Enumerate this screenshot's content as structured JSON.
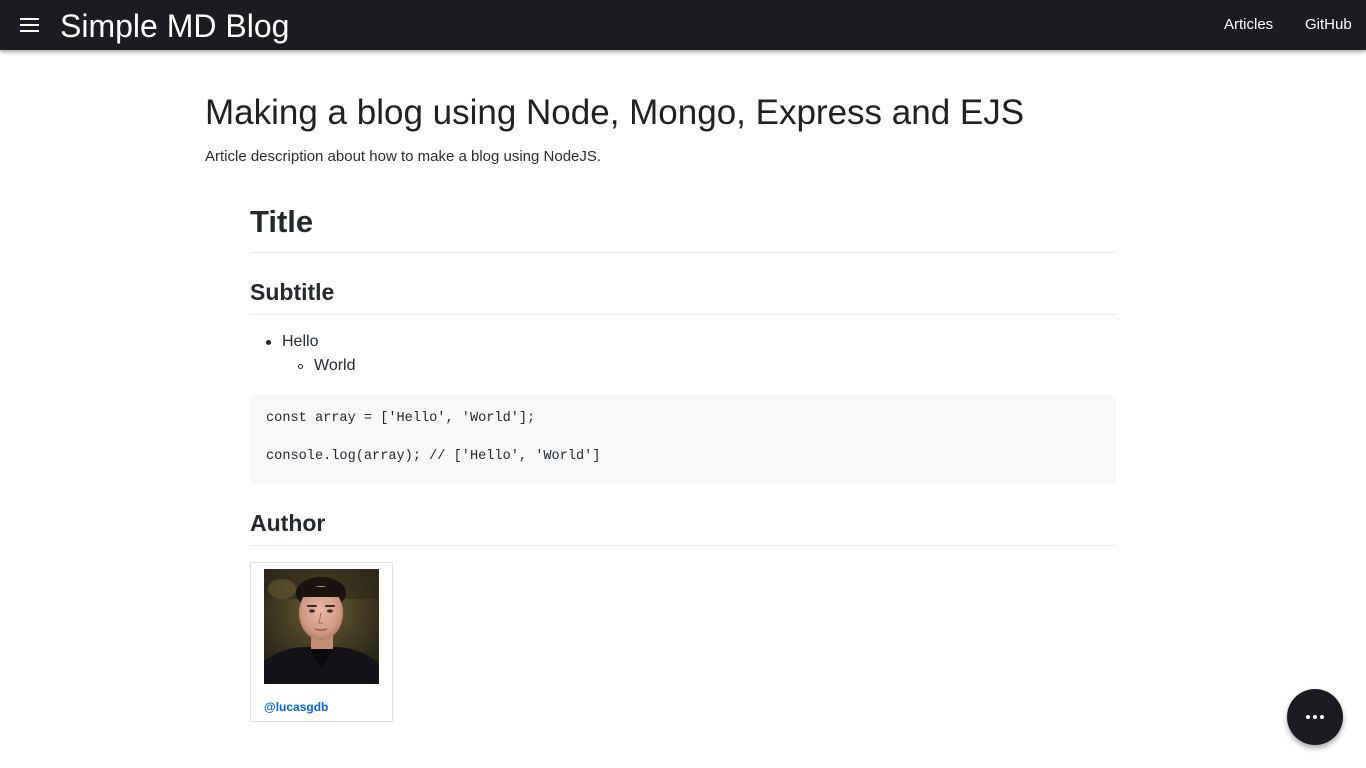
{
  "navbar": {
    "menu_icon": "menu-icon",
    "brand": "Simple MD Blog",
    "links": [
      "Articles",
      "GitHub"
    ]
  },
  "article": {
    "title": "Making a blog using Node, Mongo, Express and EJS",
    "description": "Article description about how to make a blog using NodeJS."
  },
  "markdown": {
    "h1": "Title",
    "h2_subtitle": "Subtitle",
    "list": [
      {
        "text": "Hello",
        "children": [
          "World"
        ]
      }
    ],
    "code_lines": [
      "const array = ['Hello', 'World'];",
      "",
      "console.log(array); // ['Hello', 'World']"
    ],
    "h2_author": "Author"
  },
  "author": {
    "handle": "@lucasgdb",
    "avatar_icon": "avatar-photo"
  },
  "fab": {
    "icon": "more-horizontal-icon"
  },
  "colors": {
    "navbar_bg": "#1c1b22",
    "link": "#0366d6",
    "code_bg": "#f6f8fa"
  }
}
